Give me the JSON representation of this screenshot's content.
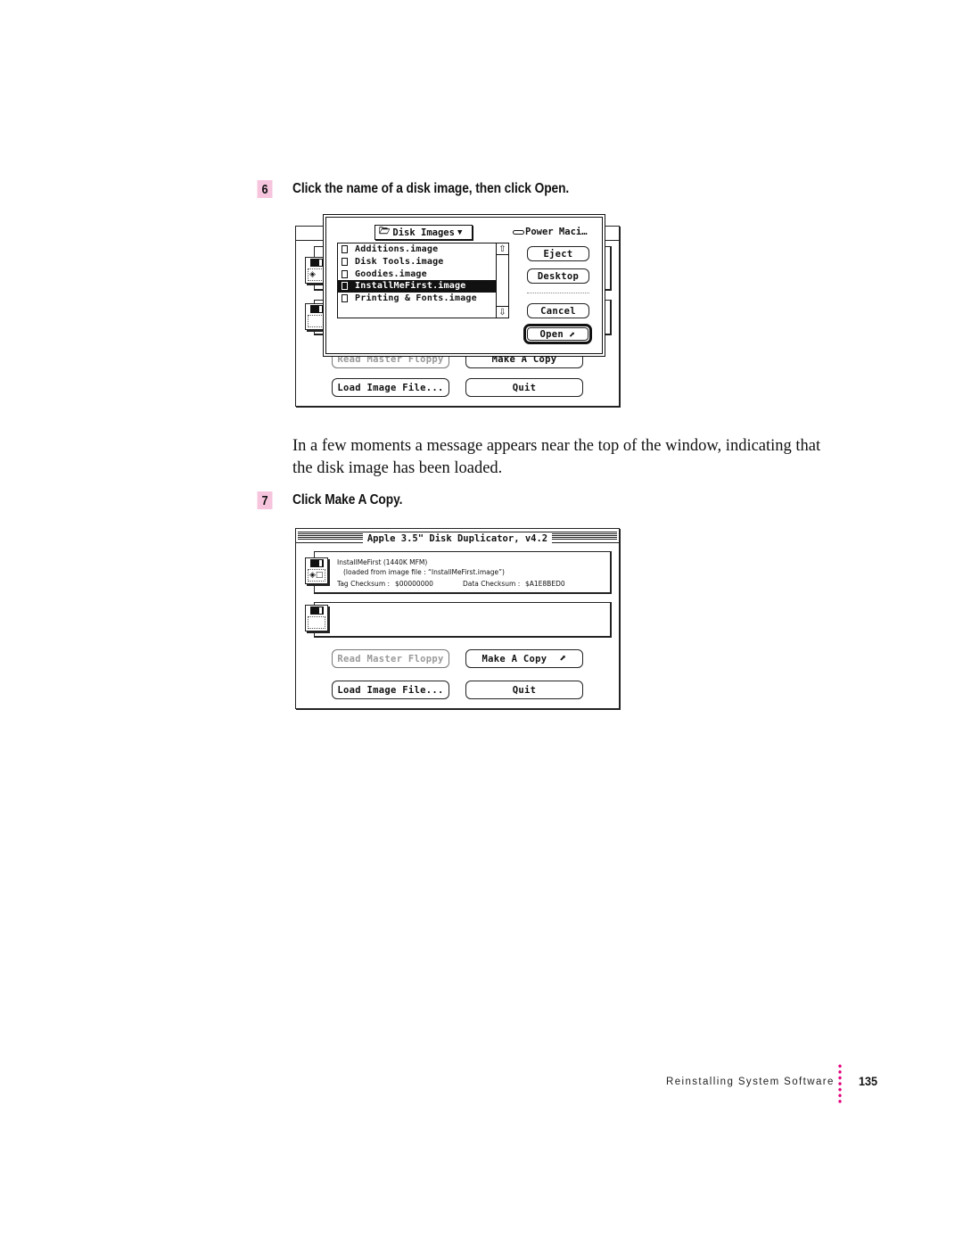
{
  "steps": [
    {
      "number": "6",
      "text": "Click the name of a disk image, then click Open."
    },
    {
      "number": "7",
      "text": "Click Make A Copy."
    }
  ],
  "paragraph": "In a few moments a message appears near the top of the window, indicating that the disk image has been loaded.",
  "open_dialog": {
    "folder_popup": "Disk Images",
    "volume": "Power Maci…",
    "files": [
      {
        "name": "Additions.image",
        "selected": false
      },
      {
        "name": "Disk Tools.image",
        "selected": false
      },
      {
        "name": "Goodies.image",
        "selected": false
      },
      {
        "name": "InstallMeFirst.image",
        "selected": true
      },
      {
        "name": "Printing & Fonts.image",
        "selected": false
      }
    ],
    "buttons": {
      "eject": "Eject",
      "desktop": "Desktop",
      "cancel": "Cancel",
      "open": "Open"
    }
  },
  "background_window": {
    "buttons": {
      "read_master": "Read Master Floppy",
      "make_copy": "Make A Copy",
      "load_image": "Load Image File...",
      "quit": "Quit"
    }
  },
  "duplicator_window": {
    "title": "Apple 3.5\" Disk Duplicator, v4.2",
    "disk_name": "InstallMeFirst  (1440K MFM)",
    "loaded_from": "(loaded from image file : “InstallMeFirst.image”)",
    "tag_checksum_label": "Tag Checksum :",
    "tag_checksum_value": "$00000000",
    "data_checksum_label": "Data Checksum :",
    "data_checksum_value": "$A1E8BED0",
    "buttons": {
      "read_master": "Read Master Floppy",
      "make_copy": "Make A Copy",
      "load_image": "Load Image File...",
      "quit": "Quit"
    }
  },
  "footer": {
    "section": "Reinstalling System Software",
    "page": "135"
  }
}
